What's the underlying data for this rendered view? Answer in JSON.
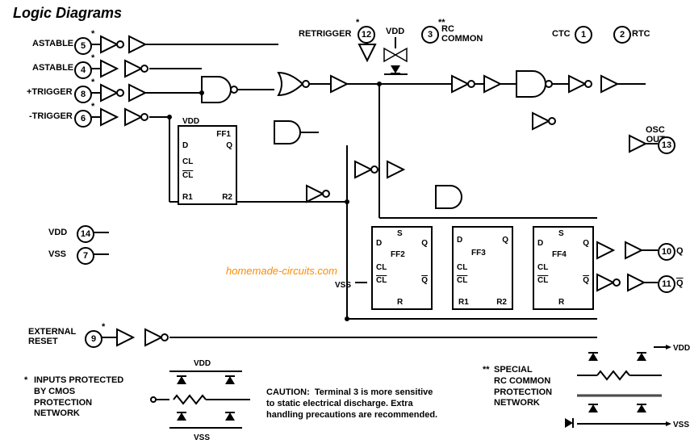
{
  "title": "Logic Diagrams",
  "watermark": "homemade-circuits.com",
  "pins": {
    "astable_a": {
      "num": "5",
      "label": "ASTABLE",
      "star": "*"
    },
    "astable_b": {
      "num": "4",
      "label": "ASTABLE",
      "star": "*"
    },
    "p_trigger": {
      "num": "8",
      "label": "+TRIGGER",
      "star": "*"
    },
    "n_trigger": {
      "num": "6",
      "label": "-TRIGGER",
      "star": "*"
    },
    "retrigger": {
      "num": "12",
      "label": "RETRIGGER",
      "star": "*"
    },
    "rc_common": {
      "num": "3",
      "label": "RC\nCOMMON",
      "star": "**"
    },
    "ctc": {
      "num": "1",
      "label": "CTC"
    },
    "rtc": {
      "num": "2",
      "label": "RTC"
    },
    "osc_out": {
      "num": "13",
      "label": "OSC\nOUT"
    },
    "q": {
      "num": "10",
      "label": "Q"
    },
    "q_bar": {
      "num": "11",
      "label": "Q"
    },
    "vdd": {
      "num": "14",
      "label": "VDD"
    },
    "vss": {
      "num": "7",
      "label": "VSS"
    },
    "ext_reset": {
      "num": "9",
      "label": "EXTERNAL\nRESET",
      "star": "*"
    }
  },
  "power": {
    "vdd": "VDD",
    "vss": "VSS"
  },
  "flipflops": {
    "ff1": {
      "name": "FF1",
      "pins": [
        "D",
        "Q",
        "CL",
        "CL",
        "R1",
        "R2"
      ]
    },
    "ff2": {
      "name": "FF2",
      "pins": [
        "D",
        "S",
        "Q",
        "CL",
        "CL",
        "Q",
        "R"
      ]
    },
    "ff3": {
      "name": "FF3",
      "pins": [
        "D",
        "Q",
        "CL",
        "CL",
        "R1",
        "R2"
      ]
    },
    "ff4": {
      "name": "FF4",
      "pins": [
        "D",
        "S",
        "Q",
        "CL",
        "CL",
        "Q",
        "R"
      ]
    }
  },
  "notes": {
    "cmos": "INPUTS PROTECTED\nBY CMOS\nPROTECTION\nNETWORK",
    "caution": "CAUTION:  Terminal 3 is more sensitive\nto static electrical discharge. Extra\nhandling precautions are recommended.",
    "special": "SPECIAL\nRC COMMON\nPROTECTION\nNETWORK"
  },
  "asterisk": {
    "single": "*",
    "double": "**"
  }
}
